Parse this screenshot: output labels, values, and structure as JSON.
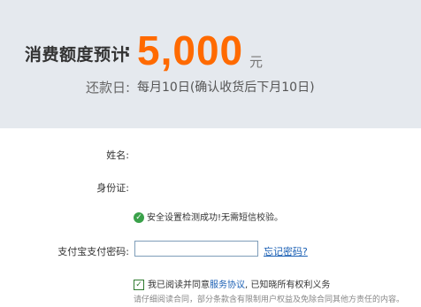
{
  "estimate": {
    "label": "消费额度预计",
    "colon": ":",
    "amount": "5,000",
    "unit": "元"
  },
  "repayment": {
    "label": "还款日",
    "colon": ":",
    "value": "每月10日(确认收货后下月10日)"
  },
  "form": {
    "name_label": "姓名:",
    "id_label": "身份证:",
    "security_notice": "安全设置检测成功!无需短信校验。",
    "password_label": "支付宝支付密码:",
    "password_value": "",
    "forgot_link": "忘记密码?"
  },
  "agreement": {
    "prefix": "我已阅读并同意",
    "link": "服务协议",
    "suffix": ", 已知晓所有权利义务",
    "checked": true,
    "disclaimer": "请仔细阅读合同，部分条款含有限制用户权益及免除合同其他方责任的内容。"
  },
  "colors": {
    "amount": "#ff6a00",
    "banner_bg": "#e5e9ee",
    "link": "#1a5fb4",
    "success_icon": "#3aa14a"
  },
  "icons": {
    "success": "check-circle-icon",
    "checkbox": "checkbox-checked-icon"
  }
}
